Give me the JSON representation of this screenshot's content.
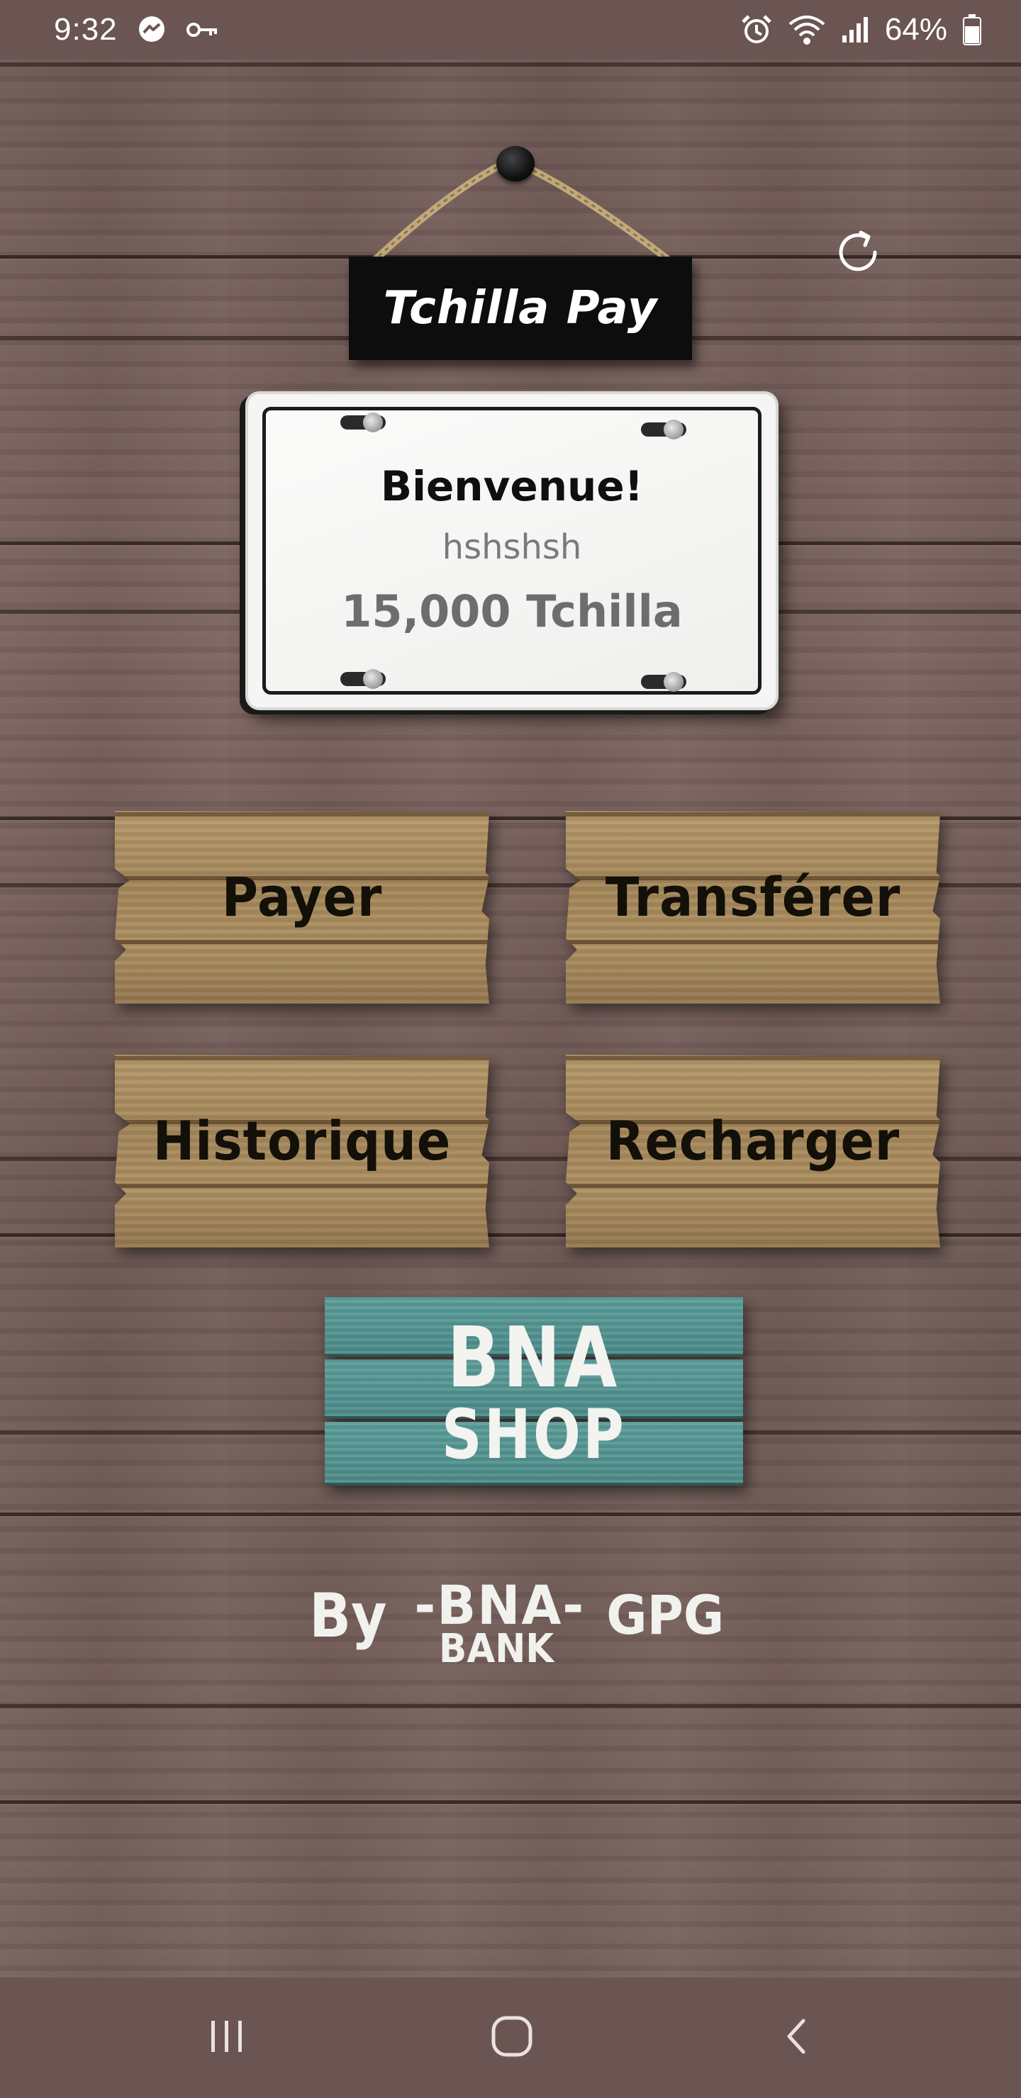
{
  "status_bar": {
    "time": "9:32",
    "battery_percent": "64%",
    "icons": [
      "messenger-icon",
      "key-icon",
      "alarm-icon",
      "wifi-icon",
      "signal-icon",
      "battery-icon"
    ]
  },
  "header": {
    "title": "Tchilla Pay",
    "refresh_icon": "refresh-icon"
  },
  "balance_card": {
    "greeting": "Bienvenue!",
    "username": "hshshsh",
    "balance": "15,000 Tchilla"
  },
  "actions": [
    {
      "label": "Payer"
    },
    {
      "label": "Transférer"
    },
    {
      "label": "Historique"
    },
    {
      "label": "Recharger"
    }
  ],
  "shop": {
    "line1": "BNA",
    "line2": "SHOP",
    "color": "#4f9290"
  },
  "credit": {
    "by": "By",
    "bna": "-BNA-",
    "bank": "BANK",
    "gpg": "GPG"
  },
  "nav_bar": {
    "icons": [
      "recent-apps-icon",
      "home-icon",
      "back-icon"
    ]
  },
  "colors": {
    "bars": "#6b5552",
    "wood_bg": "#735d58",
    "sign_black": "#0d0d0d",
    "board": "#a88b5e"
  }
}
